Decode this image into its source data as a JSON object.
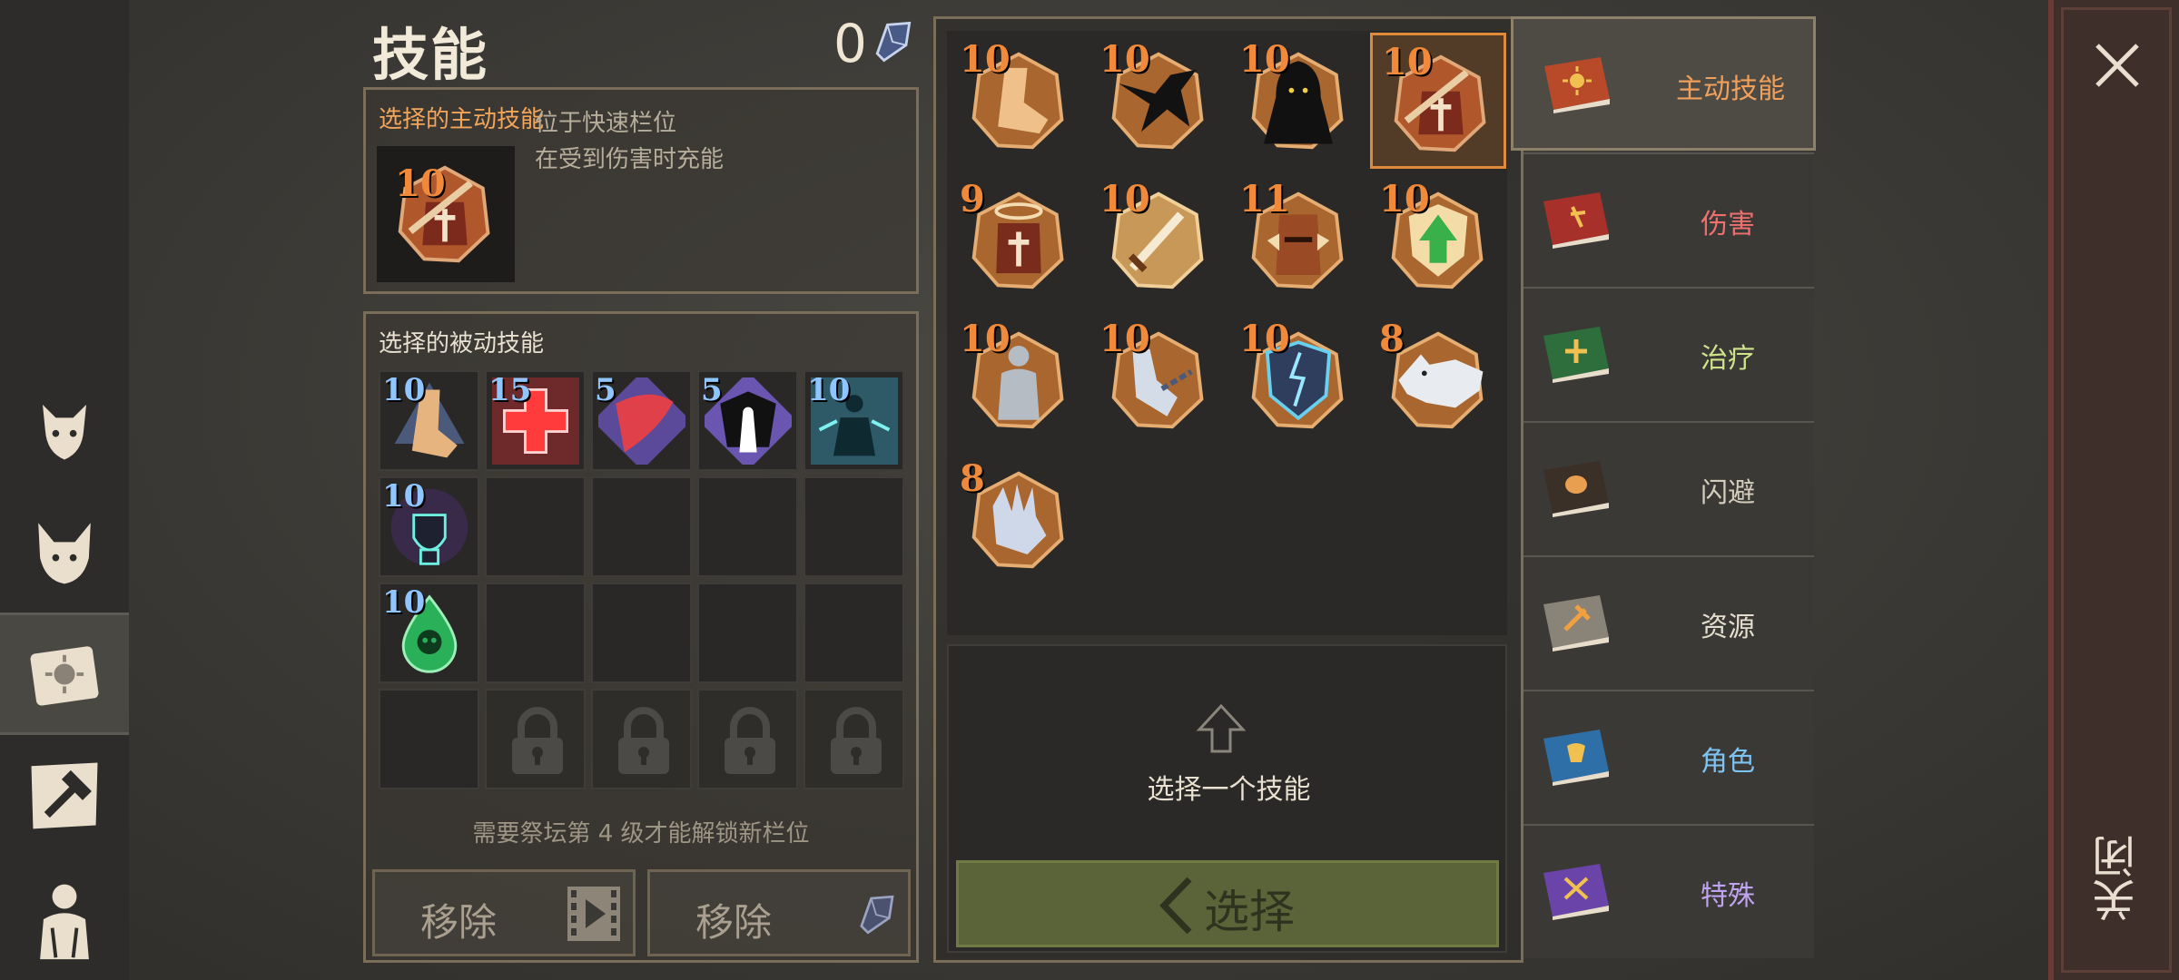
{
  "header": {
    "title": "技能",
    "currency_value": "0"
  },
  "active_skill": {
    "title": "选择的主动技能",
    "level": "10",
    "description_lines": [
      "位于快速栏位",
      "在受到伤害时充能"
    ]
  },
  "passive_skills": {
    "title": "选择的被动技能",
    "slots": [
      {
        "level": "15",
        "icon": "red-cross-icon"
      },
      {
        "level": "5",
        "icon": "red-blade-icon"
      },
      {
        "level": "5",
        "icon": "dark-silhouette-icon"
      },
      {
        "level": "10",
        "icon": "cyan-figure-icon"
      }
    ],
    "first_slot_level": "10",
    "row2_level": "10",
    "row3_level": "10",
    "unlock_note": "需要祭坛第 4 级才能解锁新栏位",
    "remove_video_label": "移除",
    "remove_crystal_label": "移除"
  },
  "skill_grid": {
    "levels": [
      "10",
      "10",
      "10",
      "10",
      "9",
      "10",
      "11",
      "10",
      "10",
      "10",
      "10",
      "8",
      "8"
    ],
    "selected_index": 3
  },
  "chooser": {
    "prompt": "选择一个技能",
    "select_label": "选择"
  },
  "tabs": [
    {
      "label": "主动技能",
      "color": "#f0a05a",
      "book": "#b84a2a"
    },
    {
      "label": "伤害",
      "color": "#f07070",
      "book": "#a8302a"
    },
    {
      "label": "治疗",
      "color": "#cfe48a",
      "book": "#2d6e3c"
    },
    {
      "label": "闪避",
      "color": "#d4cdbd",
      "book": "#3a3028"
    },
    {
      "label": "资源",
      "color": "#e4ddcd",
      "book": "#8a8478"
    },
    {
      "label": "角色",
      "color": "#7ec4f2",
      "book": "#2e6fa8"
    },
    {
      "label": "特殊",
      "color": "#c0a4f2",
      "book": "#6a44a8"
    }
  ],
  "close": {
    "label": "关闭"
  }
}
